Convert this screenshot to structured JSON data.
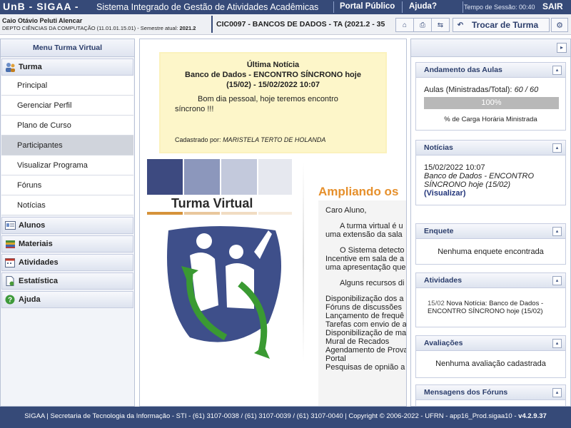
{
  "header": {
    "brand": "UnB - SIGAA -",
    "system_name": "Sistema Integrado de Gestão de Atividades Acadêmicas",
    "portal_publico": "Portal Público",
    "ajuda": "Ajuda?",
    "session_time": "Tempo de Sessão: 00:40",
    "sair": "SAIR"
  },
  "user": {
    "name": "Caio Otávio Peluti Alencar",
    "dept": "DEPTO CIÊNCIAS DA COMPUTAÇÃO (11.01.01.15.01) - Semestre atual:",
    "semester": "2021.2"
  },
  "course": {
    "title": "CIC0097 - BANCOS DE DADOS - TA (2021.2 - 35"
  },
  "toolbar": {
    "trocar_turma": "Trocar de Turma"
  },
  "menu": {
    "title": "Menu Turma Virtual",
    "turma": "Turma",
    "turma_items": [
      "Principal",
      "Gerenciar Perfil",
      "Plano de Curso",
      "Participantes",
      "Visualizar Programa",
      "Fóruns",
      "Notícias"
    ],
    "alunos": "Alunos",
    "materiais": "Materiais",
    "atividades": "Atividades",
    "estatistica": "Estatística",
    "ajuda": "Ajuda"
  },
  "news": {
    "title": "Última Notícia",
    "headline1": "Banco de Dados - ENCONTRO SÍNCRONO hoje",
    "headline2": "(15/02) - 15/02/2022 10:07",
    "body1": "Bom dia pessoal, hoje teremos encontro",
    "body2": "síncrono !!!",
    "footer_label": "Cadastrado por:",
    "author": "MARISTELA TERTO DE HOLANDA"
  },
  "logo": {
    "text": "Turma Virtual"
  },
  "intro": {
    "heading": "Ampliando os",
    "lines": [
      "Caro Aluno,",
      "A turma virtual é u",
      "uma extensão da sala",
      "O Sistema detecto",
      "Incentive em sala de a",
      "uma apresentação que",
      "Alguns recursos di",
      "Disponibilização dos a",
      "Fóruns de discussões",
      "Lançamento de frequê",
      "Tarefas com envio de a",
      "Disponibilização de ma",
      "Mural de Recados",
      "Agendamento de Prova",
      "Portal",
      "Pesquisas de opnião a"
    ]
  },
  "sidebar": {
    "andamento": {
      "title": "Andamento das Aulas",
      "label": "Aulas (Ministradas/Total):",
      "value": "60 / 60",
      "progress_text": "100%",
      "progress": 1.0,
      "caption": "% de Carga Horária Ministrada"
    },
    "noticias": {
      "title": "Notícias",
      "date": "15/02/2022 10:07",
      "text": "Banco de Dados - ENCONTRO SÍNCRONO hoje (15/02)",
      "link": "(Visualizar)"
    },
    "enquete": {
      "title": "Enquete",
      "text": "Nenhuma enquete encontrada"
    },
    "atividades": {
      "title": "Atividades",
      "date": "15/02",
      "text": "Nova Notícia: Banco de Dados - ENCONTRO SÍNCRONO hoje (15/02)"
    },
    "avaliacoes": {
      "title": "Avaliações",
      "text": "Nenhuma avaliação cadastrada"
    },
    "mensagens": {
      "title": "Mensagens dos Fóruns"
    }
  },
  "footer": {
    "text": "SIGAA | Secretaria de Tecnologia da Informação - STI - (61) 3107-0038 / (61) 3107-0039 / (61) 3107-0040 | Copyright © 2006-2022 - UFRN - app16_Prod.sigaa10 -",
    "version": "v4.2.9.37"
  },
  "colors": {
    "topbar": "#364a78",
    "accent_orange": "#e6902c",
    "news_bg": "#fdf6c9"
  }
}
